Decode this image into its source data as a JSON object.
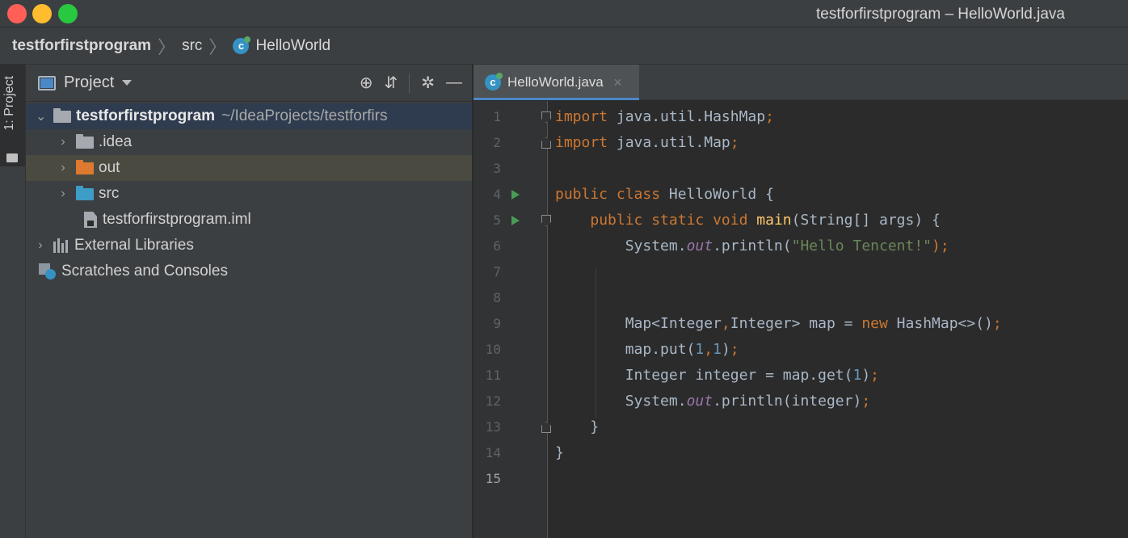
{
  "window": {
    "title": "testforfirstprogram – HelloWorld.java"
  },
  "breadcrumb": {
    "project": "testforfirstprogram",
    "folder": "src",
    "file": "HelloWorld"
  },
  "stripe": {
    "label": "1: Project"
  },
  "project_panel": {
    "title": "Project",
    "tree": {
      "root_name": "testforfirstprogram",
      "root_path": "~/IdeaProjects/testforfirs",
      "items": [
        {
          "label": ".idea",
          "icon": "folder-icon"
        },
        {
          "label": "out",
          "icon": "folder-orange-icon"
        },
        {
          "label": "src",
          "icon": "folder-blue-icon"
        },
        {
          "label": "testforfirstprogram.iml",
          "icon": "module-file-icon"
        }
      ],
      "external_libraries": "External Libraries",
      "scratches": "Scratches and Consoles"
    }
  },
  "editor": {
    "tab_label": "HelloWorld.java",
    "line_numbers": [
      "1",
      "2",
      "3",
      "4",
      "5",
      "6",
      "7",
      "8",
      "9",
      "10",
      "11",
      "12",
      "13",
      "14",
      "15"
    ],
    "current_line": "15",
    "code": {
      "l1": [
        "import",
        " java.util.HashMap",
        ";"
      ],
      "l2": [
        "import",
        " java.util.Map",
        ";"
      ],
      "l4": [
        "public class",
        " HelloWorld {"
      ],
      "l5": [
        "public static void",
        " ",
        "main",
        "(String[] args) {"
      ],
      "l6": [
        "System.",
        "out",
        ".println(",
        "\"Hello Tencent!\"",
        ");"
      ],
      "l9": [
        "Map<Integer",
        ",",
        "Integer> map = ",
        "new",
        " HashMap<>()",
        ";"
      ],
      "l10": [
        "map.put(",
        "1",
        ",",
        "1",
        ")",
        ";"
      ],
      "l11": [
        "Integer integer = map.get(",
        "1",
        ")",
        ";"
      ],
      "l12": [
        "System.",
        "out",
        ".println(integer)",
        ";"
      ],
      "l13": [
        "}"
      ],
      "l14": [
        "}"
      ]
    }
  }
}
